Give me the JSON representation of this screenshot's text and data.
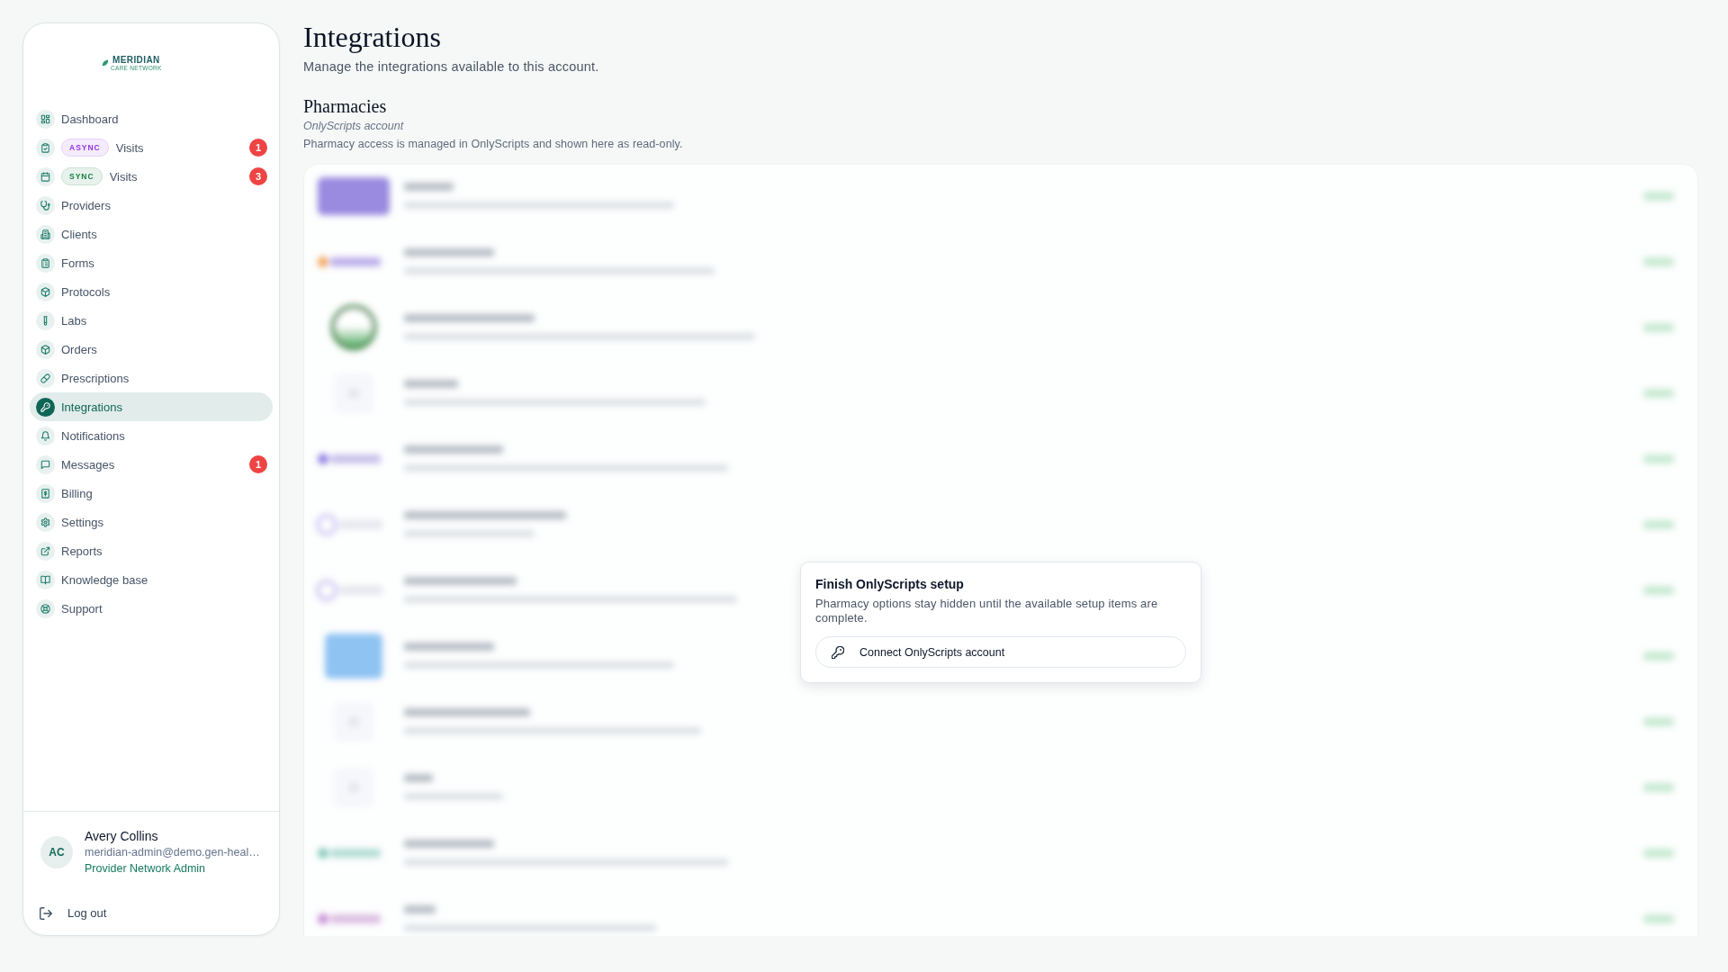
{
  "sidebar": {
    "logo": {
      "name": "MERIDIAN",
      "tagline": "CARE NETWORK"
    },
    "nav_items": [
      {
        "label": "Dashboard",
        "selected": false
      },
      {
        "label": "Visits",
        "tag": {
          "text": "ASYNC",
          "color": "#9333ea"
        },
        "badge": "1",
        "selected": false
      },
      {
        "label": "Visits",
        "tag": {
          "text": "SYNC",
          "color": "#15803d"
        },
        "badge": "3",
        "selected": false
      },
      {
        "label": "Providers",
        "selected": false
      },
      {
        "label": "Clients",
        "selected": false
      },
      {
        "label": "Forms",
        "selected": false
      },
      {
        "label": "Protocols",
        "selected": false
      },
      {
        "label": "Labs",
        "selected": false
      },
      {
        "label": "Orders",
        "selected": false
      },
      {
        "label": "Prescriptions",
        "selected": false
      },
      {
        "label": "Integrations",
        "selected": true
      },
      {
        "label": "Notifications",
        "selected": false
      },
      {
        "label": "Messages",
        "badge": "1",
        "selected": false
      },
      {
        "label": "Billing",
        "selected": false
      },
      {
        "label": "Settings",
        "selected": false
      },
      {
        "label": "Reports",
        "selected": false
      },
      {
        "label": "Knowledge base",
        "selected": false
      },
      {
        "label": "Support",
        "selected": false
      }
    ],
    "user": {
      "initials": "AC",
      "name": "Avery Collins",
      "email": "meridian-admin@demo.gen-heal…",
      "role": "Provider Network Admin"
    },
    "logout": "Log out"
  },
  "page": {
    "title": "Integrations",
    "subtitle": "Manage the integrations available to this account."
  },
  "section": {
    "title": "Pharmacies",
    "account": "OnlyScripts account",
    "description": "Pharmacy access is managed in OnlyScripts and shown here as read-only."
  },
  "setup_prompt": {
    "title": "Finish OnlyScripts setup",
    "text": "Pharmacy options stay hidden until the available setup items are complete.",
    "button": "Connect OnlyScripts account"
  }
}
